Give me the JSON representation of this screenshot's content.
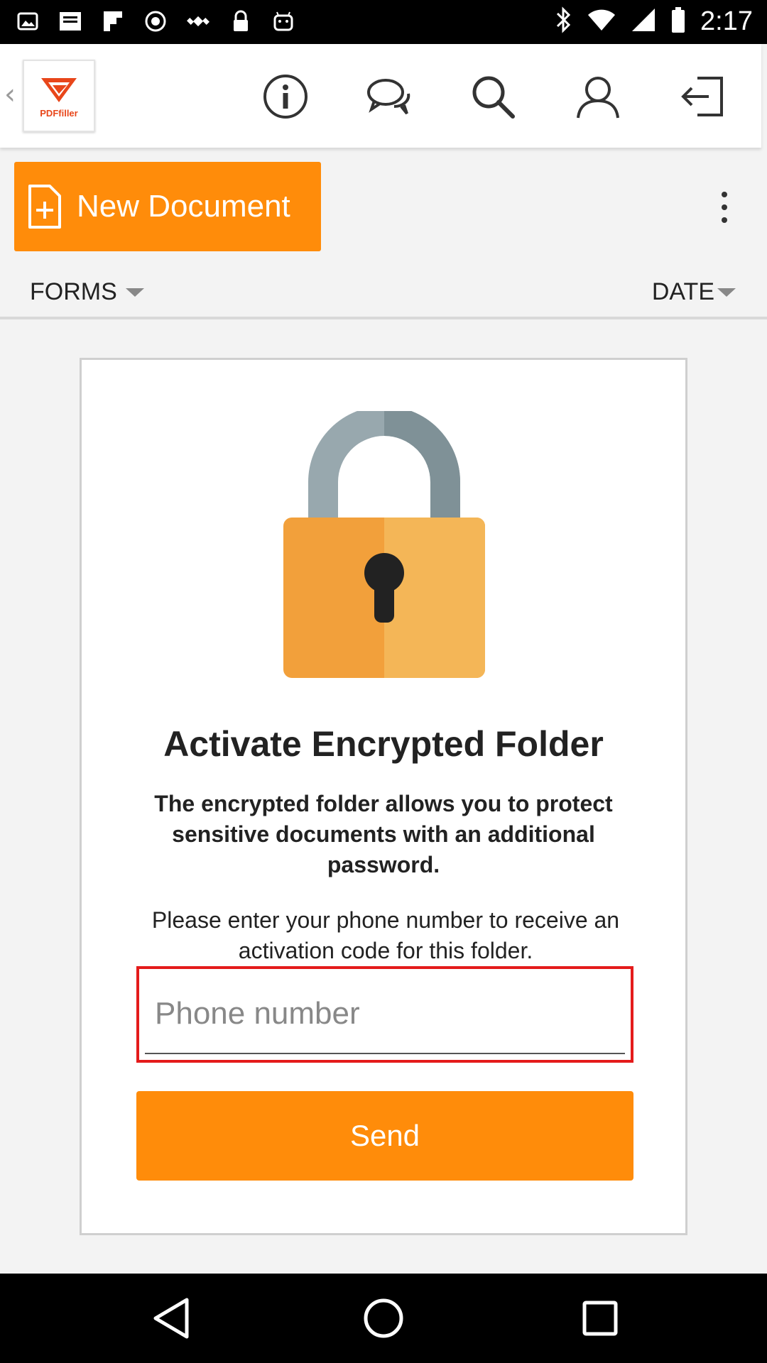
{
  "status_bar": {
    "time": "2:17",
    "left_icons": [
      "image-icon",
      "notification-icon",
      "flipboard-icon",
      "sync-icon",
      "satellite-icon",
      "lock-icon",
      "android-icon"
    ],
    "right_icons": [
      "bluetooth-icon",
      "wifi-icon",
      "signal-icon",
      "battery-icon"
    ]
  },
  "app_bar": {
    "logo_text": "PDFfiller",
    "icons": [
      "info-icon",
      "chat-icon",
      "search-icon",
      "profile-icon",
      "logout-icon"
    ]
  },
  "toolbar": {
    "new_document_label": "New Document",
    "forms_label": "FORMS",
    "date_label": "DATE"
  },
  "dialog": {
    "title": "Activate Encrypted Folder",
    "description": "The encrypted folder allows you to protect sensitive documents with an additional password.",
    "prompt": "Please enter your phone number to receive an activation code for this folder.",
    "phone_placeholder": "Phone number",
    "phone_value": "",
    "send_label": "Send"
  },
  "colors": {
    "accent": "#ff8c0a",
    "error_border": "#e41b1b",
    "lock_body": "#f2a03b",
    "lock_shackle": "#98a8ae"
  },
  "nav_bar": {
    "buttons": [
      "back-icon",
      "home-icon",
      "recents-icon"
    ]
  }
}
